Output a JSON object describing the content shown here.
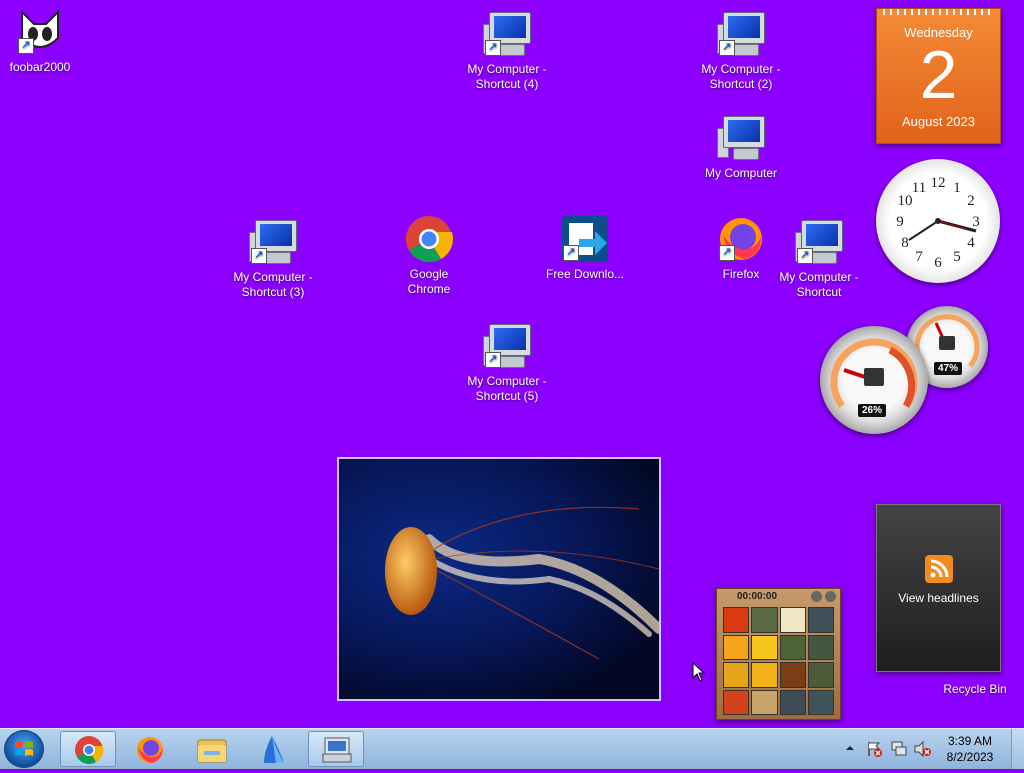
{
  "desktop_icons": [
    {
      "label": "foobar2000"
    },
    {
      "label": "My Computer - Shortcut (4)"
    },
    {
      "label": "My Computer - Shortcut (2)"
    },
    {
      "label": "My Computer"
    },
    {
      "label": "My Computer - Shortcut (3)"
    },
    {
      "label": "Google Chrome"
    },
    {
      "label": "Free Downlo..."
    },
    {
      "label": "Firefox"
    },
    {
      "label": "My Computer - Shortcut"
    },
    {
      "label": "My Computer - Shortcut (5)"
    },
    {
      "label": "Recycle Bin"
    }
  ],
  "calendar": {
    "weekday": "Wednesday",
    "day": "2",
    "month_year": "August 2023"
  },
  "clock_gadget": {
    "numerals": [
      "12",
      "1",
      "2",
      "3",
      "4",
      "5",
      "6",
      "7",
      "8",
      "9",
      "10",
      "11"
    ]
  },
  "cpu_meter": {
    "cpu": "26%",
    "memory": "47%"
  },
  "headlines": {
    "label": "View headlines"
  },
  "puzzle": {
    "timer": "00:00:00"
  },
  "taskbar": {
    "items": [
      "start-button",
      "chrome",
      "firefox",
      "file-explorer",
      "app",
      "remote-desktop"
    ],
    "time": "3:39 AM",
    "date": "8/2/2023"
  }
}
